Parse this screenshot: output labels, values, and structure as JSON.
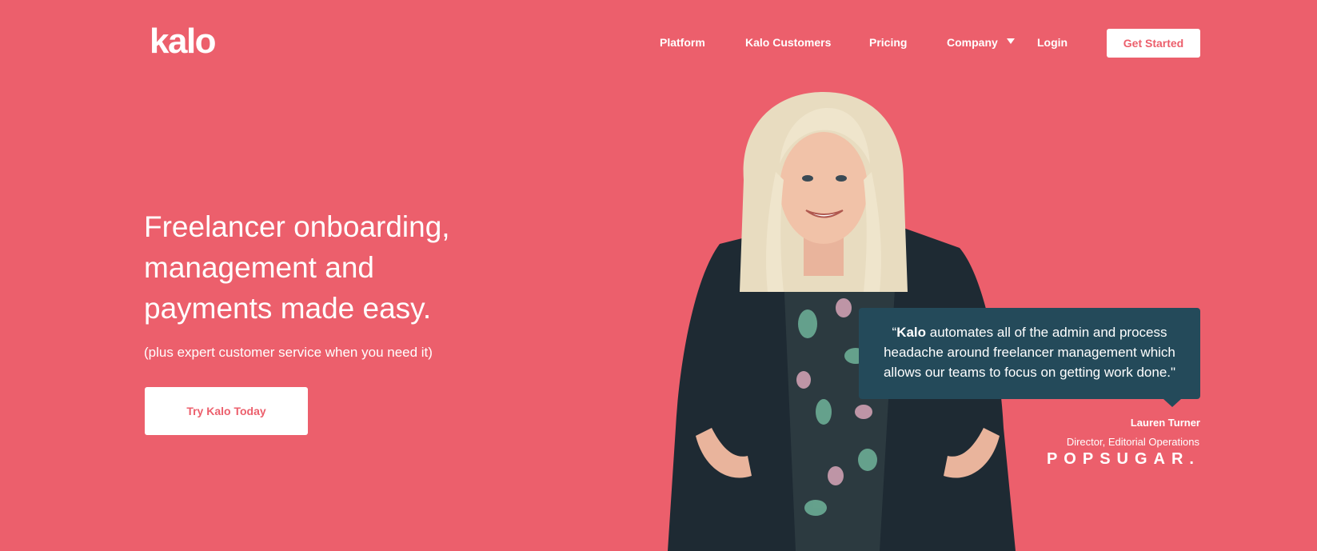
{
  "brand": {
    "logo": "kalo"
  },
  "nav": {
    "items": [
      "Platform",
      "Kalo Customers",
      "Pricing",
      "Company",
      "Login"
    ],
    "cta": "Get Started"
  },
  "hero": {
    "headline": "Freelancer onboarding, management and payments made easy.",
    "subline": "(plus expert customer service when you need it)",
    "cta": "Try Kalo Today"
  },
  "testimonial": {
    "open_quote": "“",
    "brand_word": "Kalo",
    "quote_rest": " automates all of the admin and process headache around freelancer management which allows our teams to focus on getting work done.\"",
    "name": "Lauren Turner",
    "title": "Director, Editorial Operations",
    "company": "POPSUGAR."
  },
  "colors": {
    "background": "#ec5f6c",
    "quote_box": "#244a5a",
    "button_text": "#ec5f6c"
  }
}
